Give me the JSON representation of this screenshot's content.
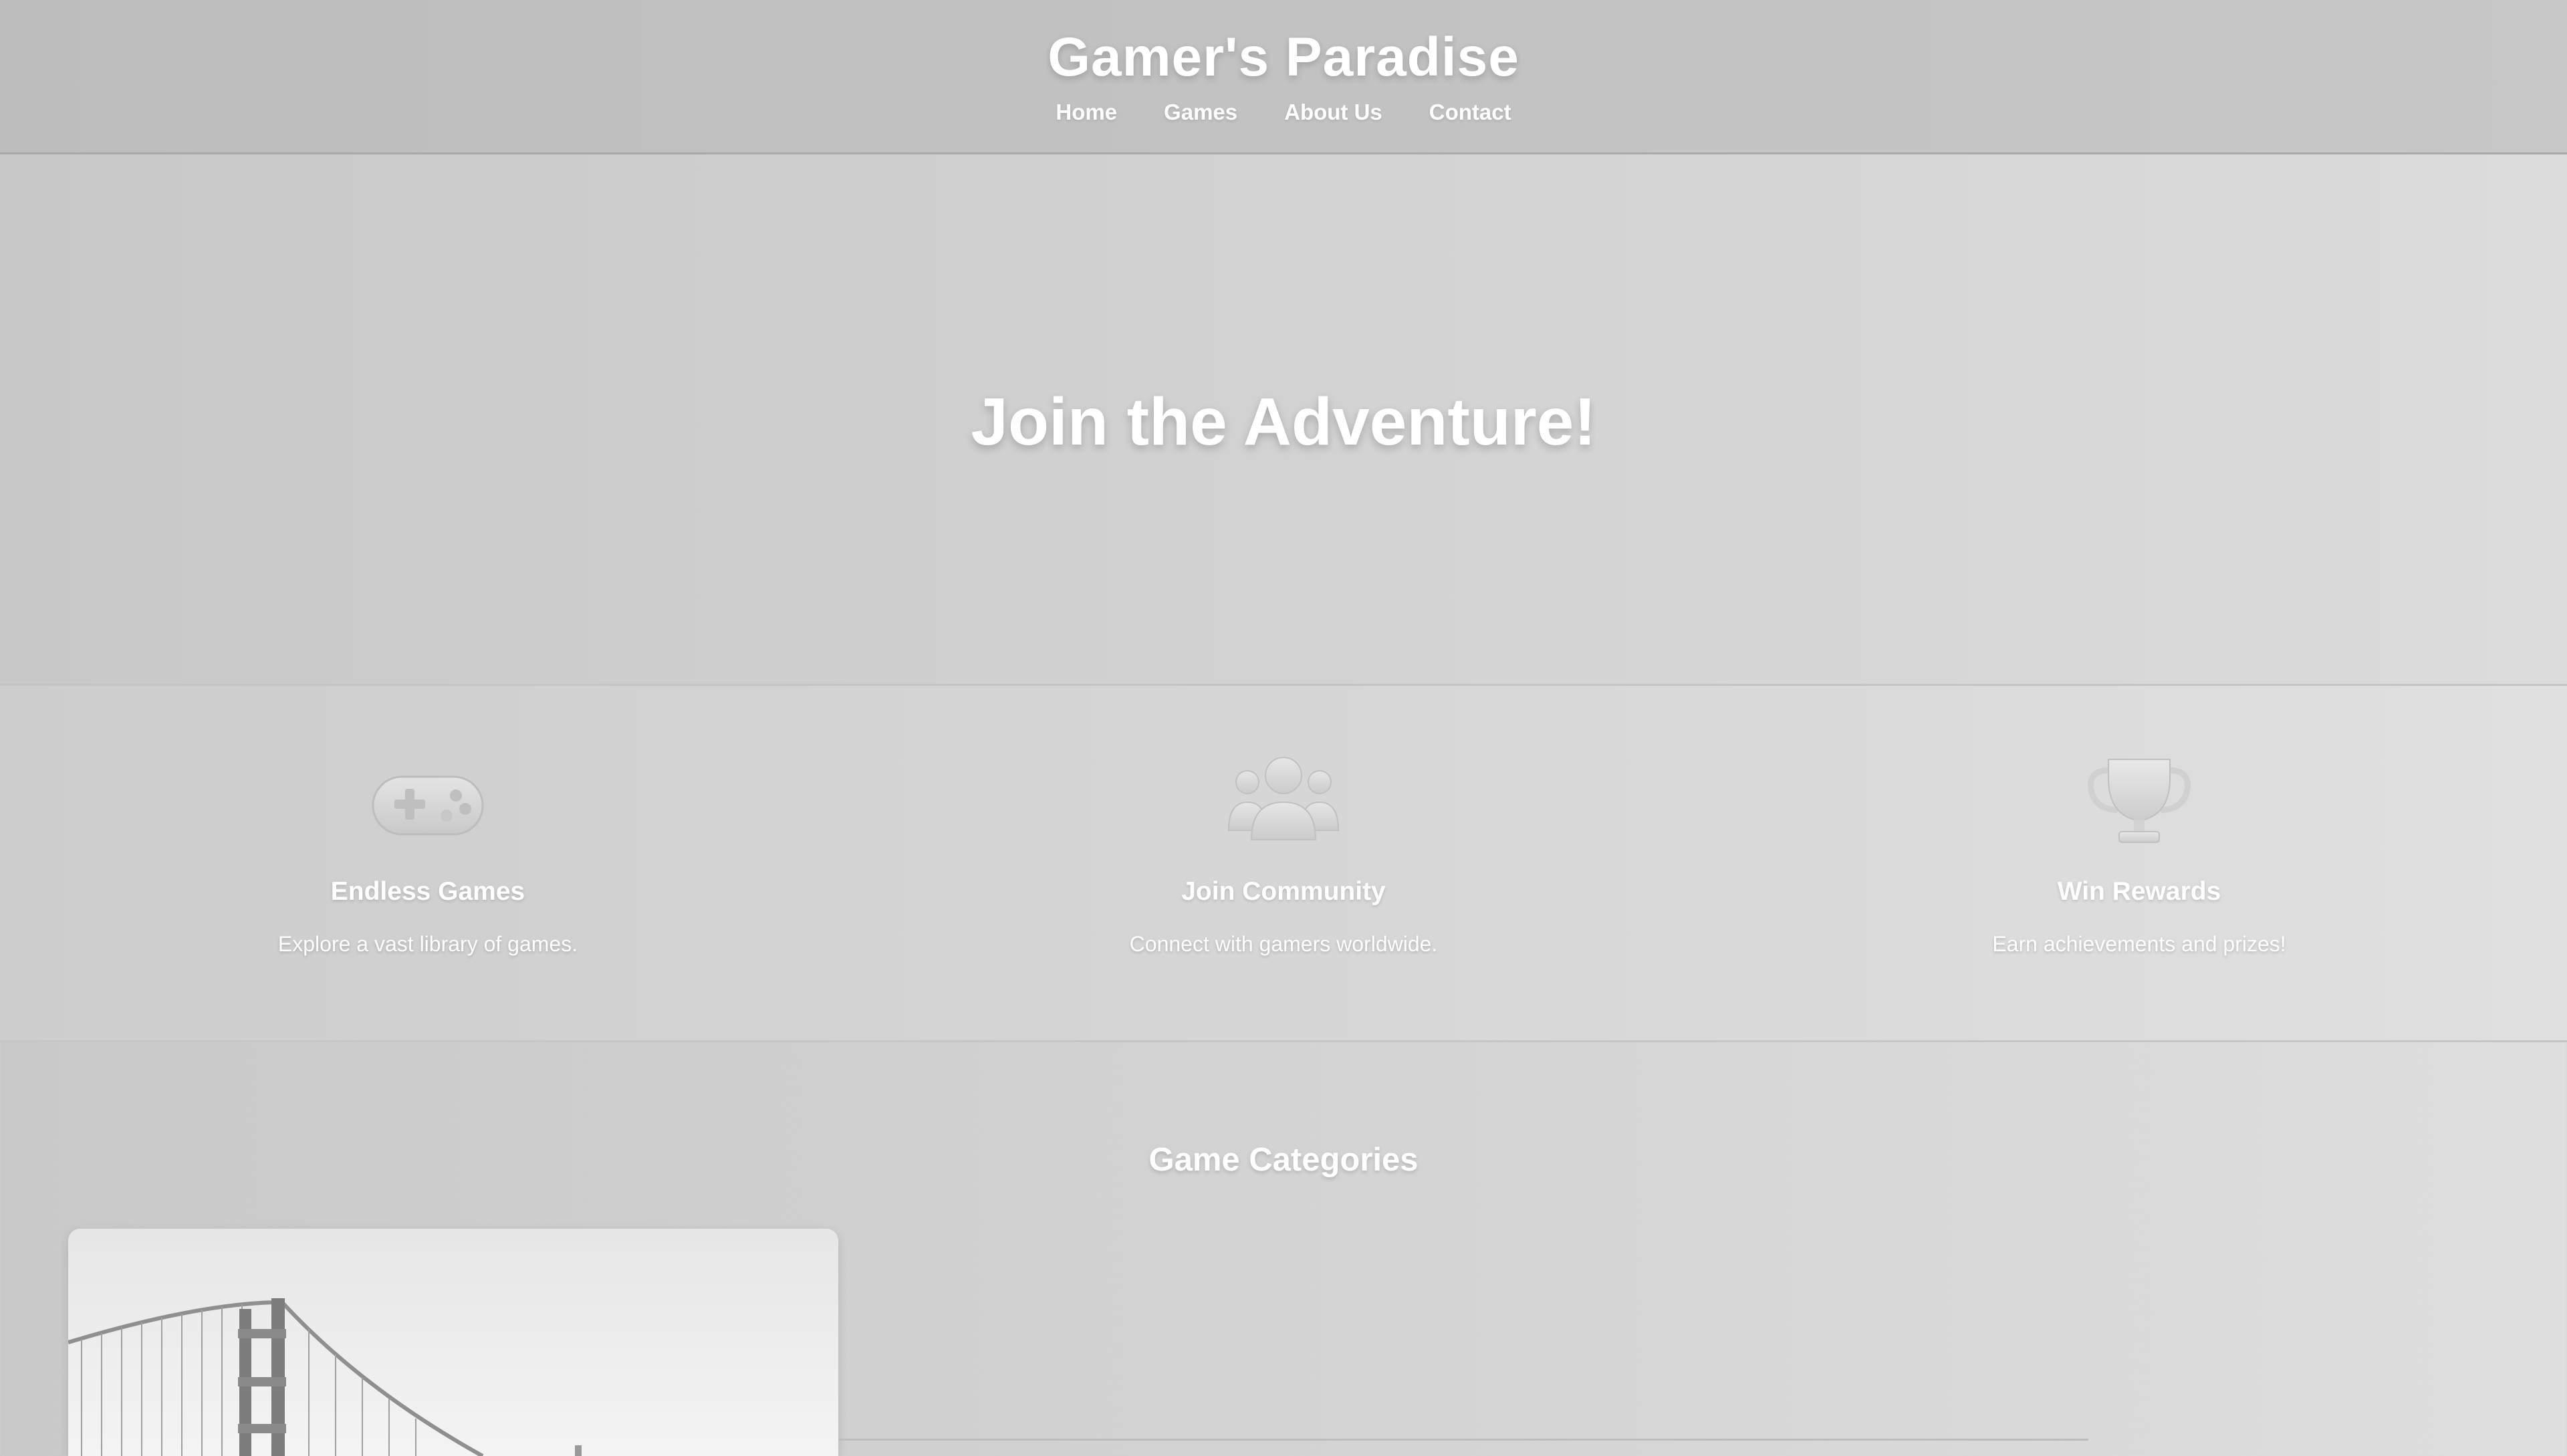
{
  "header": {
    "site_title": "Gamer's Paradise",
    "nav": [
      "Home",
      "Games",
      "About Us",
      "Contact"
    ]
  },
  "hero": {
    "title": "Join the Adventure!"
  },
  "features": [
    {
      "icon": "gamepad-icon",
      "title": "Endless Games",
      "description": "Explore a vast library of games."
    },
    {
      "icon": "community-icon",
      "title": "Join Community",
      "description": "Connect with gamers worldwide."
    },
    {
      "icon": "trophy-icon",
      "title": "Win Rewards",
      "description": "Earn achievements and prizes!"
    }
  ],
  "categories": {
    "title": "Game Categories",
    "cards": [
      {
        "image": "bridge-photo"
      }
    ]
  },
  "colors": {
    "text": "#ffffff",
    "header_bg": "#c0c0c0",
    "page_bg": "#d3d3d3"
  }
}
